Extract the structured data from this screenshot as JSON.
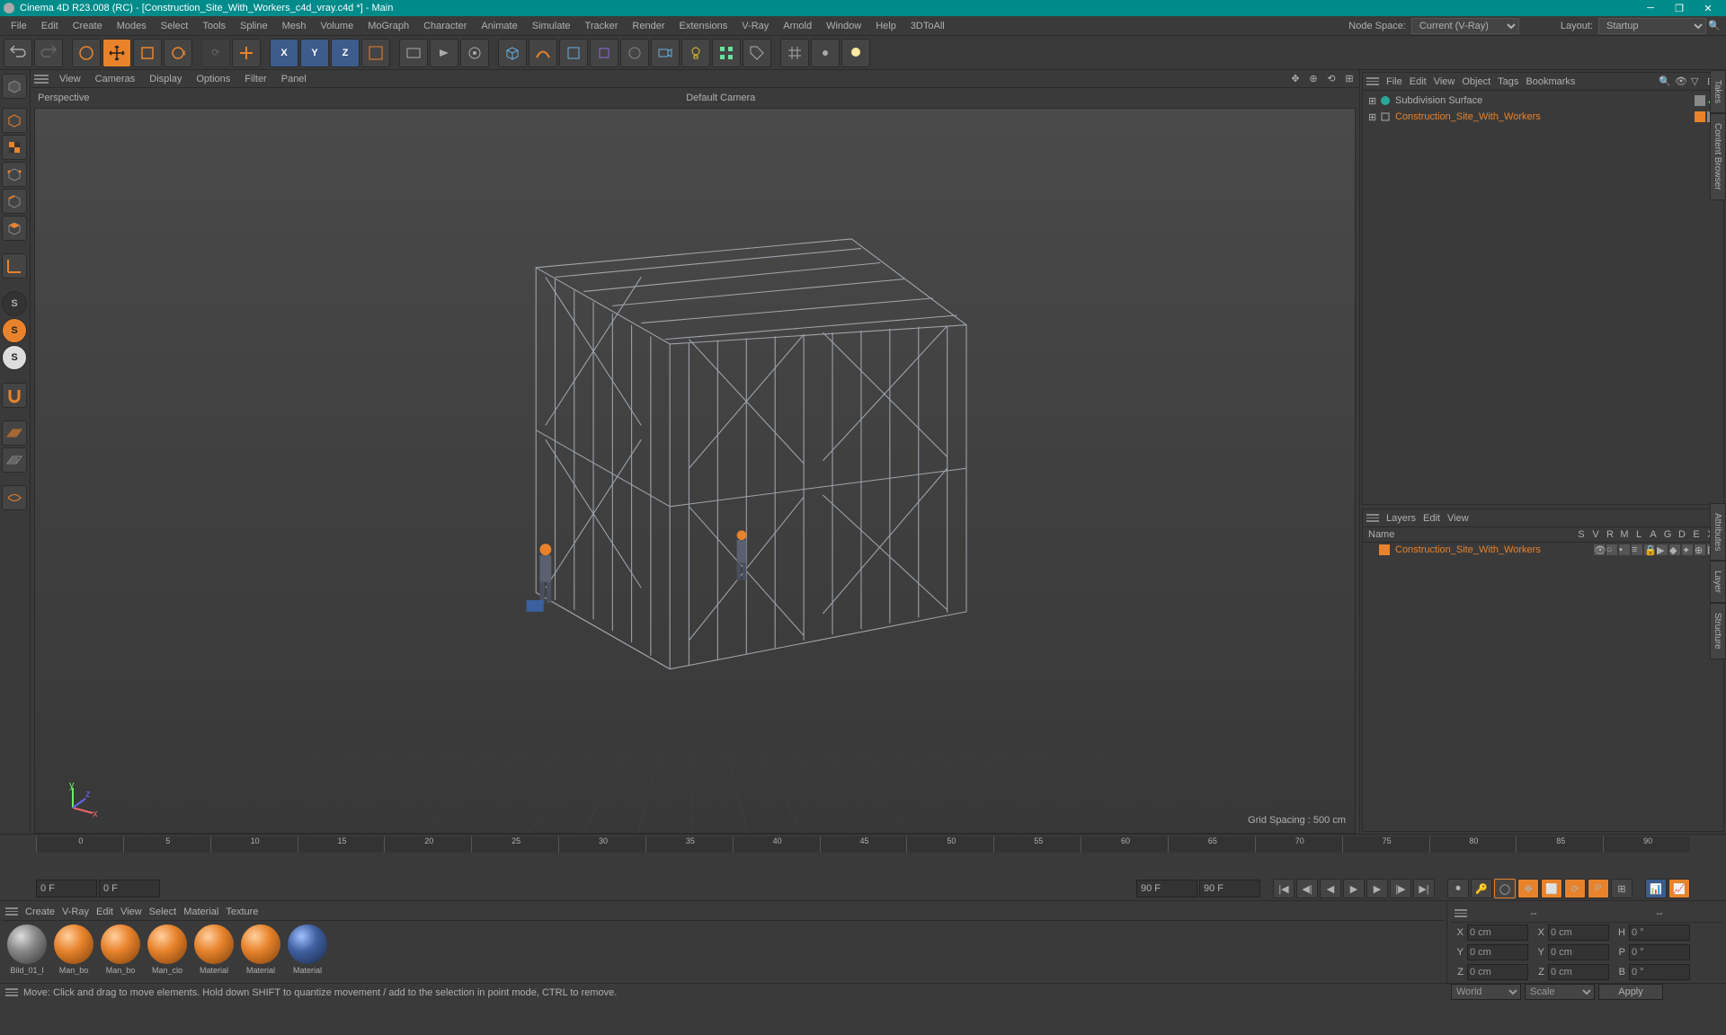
{
  "app": {
    "title": "Cinema 4D R23.008 (RC) - [Construction_Site_With_Workers_c4d_vray.c4d *] - Main"
  },
  "mainMenu": [
    "File",
    "Edit",
    "Create",
    "Modes",
    "Select",
    "Tools",
    "Spline",
    "Mesh",
    "Volume",
    "MoGraph",
    "Character",
    "Animate",
    "Simulate",
    "Tracker",
    "Render",
    "Extensions",
    "V-Ray",
    "Arnold",
    "Window",
    "Help",
    "3DToAll"
  ],
  "nodeSpace": {
    "label": "Node Space:",
    "value": "Current (V-Ray)"
  },
  "layout": {
    "label": "Layout:",
    "value": "Startup"
  },
  "viewportMenu": [
    "View",
    "Cameras",
    "Display",
    "Options",
    "Filter",
    "Panel"
  ],
  "viewport": {
    "label": "Perspective",
    "camera": "Default Camera ",
    "gridSpacing": "Grid Spacing : 500 cm"
  },
  "objectsMenu": [
    "File",
    "Edit",
    "View",
    "Object",
    "Tags",
    "Bookmarks"
  ],
  "objects": {
    "items": [
      {
        "name": "Subdivision Surface",
        "level": 0,
        "expandable": true,
        "iconColor": "#2aa"
      },
      {
        "name": "Construction_Site_With_Workers",
        "level": 0,
        "expandable": true,
        "iconColor": "#888"
      }
    ]
  },
  "layersMenu": [
    "Layers",
    "Edit",
    "View"
  ],
  "layersHeader": {
    "name": "Name",
    "cols": [
      "S",
      "V",
      "R",
      "M",
      "L",
      "A",
      "G",
      "D",
      "E",
      "X"
    ]
  },
  "layers": [
    {
      "name": "Construction_Site_With_Workers"
    }
  ],
  "timeline": {
    "ticks": [
      "0",
      "5",
      "10",
      "15",
      "20",
      "25",
      "30",
      "35",
      "40",
      "45",
      "50",
      "55",
      "60",
      "65",
      "70",
      "75",
      "80",
      "85",
      "90"
    ],
    "start": "0 F",
    "current": "0 F",
    "end1": "90 F",
    "end2": "90 F"
  },
  "materialsMenu": [
    "Create",
    "V-Ray",
    "Edit",
    "View",
    "Select",
    "Material",
    "Texture"
  ],
  "materials": [
    {
      "name": "Bild_01_l",
      "type": "gray"
    },
    {
      "name": "Man_bo",
      "type": "orange"
    },
    {
      "name": "Man_bo",
      "type": "orange"
    },
    {
      "name": "Man_clo",
      "type": "orange"
    },
    {
      "name": "Material",
      "type": "orange"
    },
    {
      "name": "Material",
      "type": "orange"
    },
    {
      "name": "Material",
      "type": "blue"
    }
  ],
  "coords": {
    "pos": {
      "X": "0 cm",
      "Y": "0 cm",
      "Z": "0 cm"
    },
    "scl": {
      "X": "0 cm",
      "Y": "0 cm",
      "Z": "0 cm"
    },
    "rot": {
      "H": "0 °",
      "P": "0 °",
      "B": "0 °"
    },
    "system": "World",
    "mode": "Scale",
    "apply": "Apply"
  },
  "statusBar": "Move: Click and drag to move elements. Hold down SHIFT to quantize movement / add to the selection in point mode, CTRL to remove."
}
